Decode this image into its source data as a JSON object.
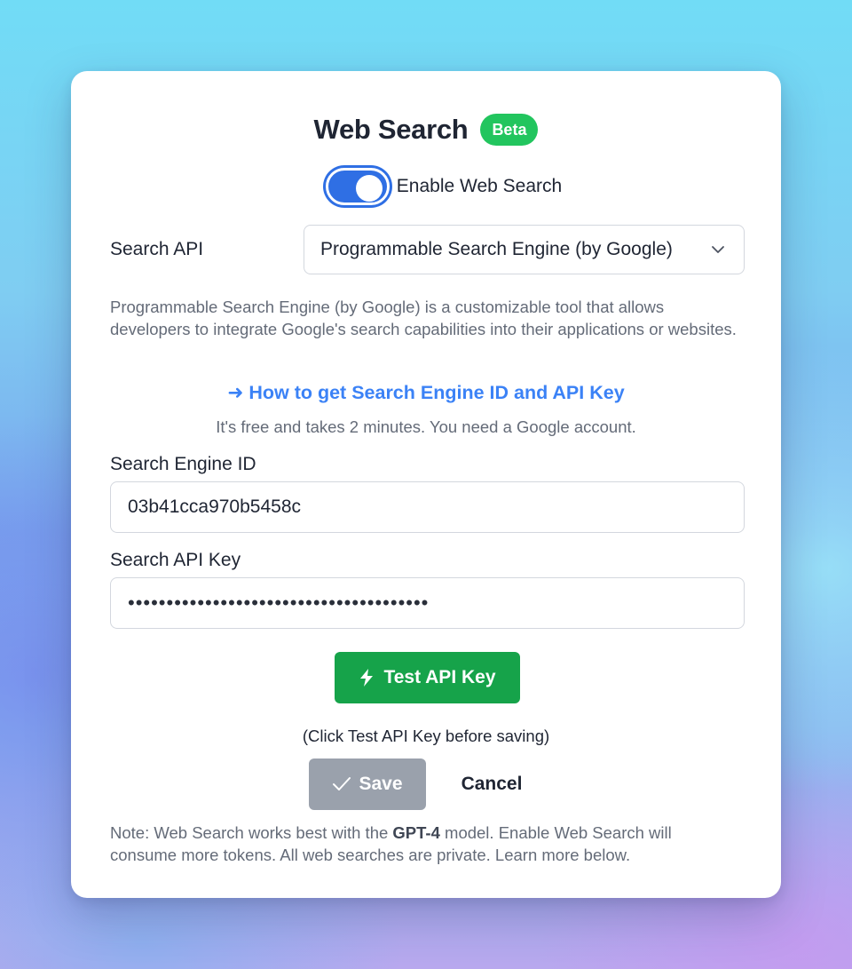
{
  "dialog": {
    "title": "Web Search",
    "badge": "Beta"
  },
  "toggle": {
    "label": "Enable Web Search",
    "enabled": true
  },
  "search_api": {
    "label": "Search API",
    "selected": "Programmable Search Engine (by Google)",
    "description": "Programmable Search Engine (by Google) is a customizable tool that allows developers to integrate Google's search capabilities into their applications or websites."
  },
  "howto": {
    "arrow": "➜",
    "link_text": "How to get Search Engine ID and API Key",
    "note": "It's free and takes 2 minutes. You need a Google account."
  },
  "engine_id": {
    "label": "Search Engine ID",
    "value": "03b41cca970b5458c"
  },
  "api_key": {
    "label": "Search API Key",
    "masked_value": "•••••••••••••••••••••••••••••••••••••••"
  },
  "actions": {
    "test_label": "Test API Key",
    "test_note": "(Click Test API Key before saving)",
    "save_label": "Save",
    "cancel_label": "Cancel"
  },
  "footnote": {
    "prefix": "Note: Web Search works best with the ",
    "model": "GPT-4",
    "suffix": " model. Enable Web Search will consume more tokens. All web searches are private. Learn more below."
  },
  "colors": {
    "accent_blue": "#2f6fe4",
    "link_blue": "#3b82f6",
    "badge_green": "#22c55e",
    "test_green": "#16a34a",
    "save_gray": "#9aa1ac"
  },
  "icons": {
    "select": "chevron-down-icon",
    "test": "lightning-bolt-icon",
    "save": "checkmark-icon",
    "howto": "arrow-right-icon"
  }
}
